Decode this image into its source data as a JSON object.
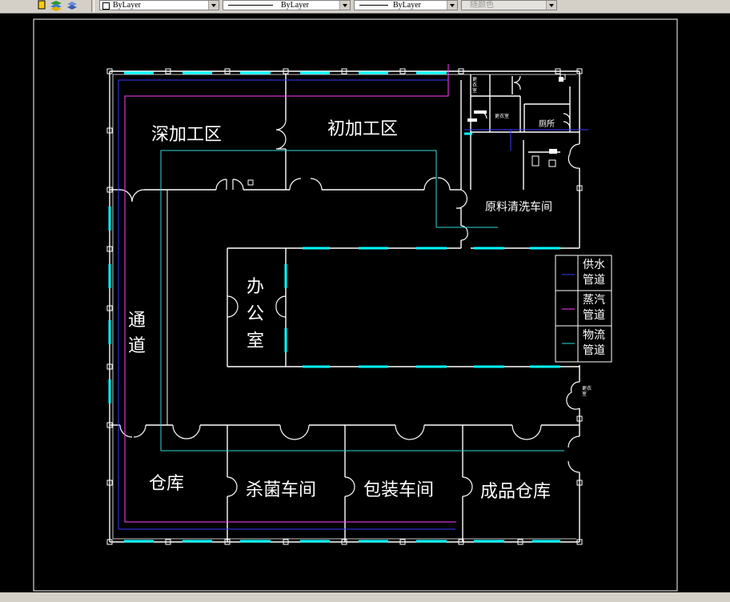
{
  "toolbar": {
    "color_combo": "ByLayer",
    "linetype_combo": "ByLayer",
    "lineweight_combo": "ByLayer",
    "plotstyle_combo": "随颜色"
  },
  "plan": {
    "deep_processing": "深加工区",
    "initial_processing": "初加工区",
    "raw_washing": "原料清洗车间",
    "office_line1": "办",
    "office_line2": "公",
    "office_line3": "室",
    "passage_line1": "通",
    "passage_line2": "道",
    "warehouse": "仓库",
    "sterilization": "杀菌车间",
    "packaging": "包装车间",
    "finished_warehouse": "成品仓库",
    "toilet": "厕所",
    "small_room_text": "更衣室"
  },
  "legend": {
    "items": [
      {
        "line1": "供水",
        "line2": "管道",
        "color": "#3a3aff"
      },
      {
        "line1": "蒸汽",
        "line2": "管道",
        "color": "#ff40ff"
      },
      {
        "line1": "物流",
        "line2": "管道",
        "color": "#30d8d8"
      }
    ]
  },
  "colors": {
    "wall": "#ffffff",
    "window": "#00ffff",
    "water": "#3a3aff",
    "steam": "#ff40ff",
    "logistics": "#30d8d8",
    "background": "#000000"
  }
}
